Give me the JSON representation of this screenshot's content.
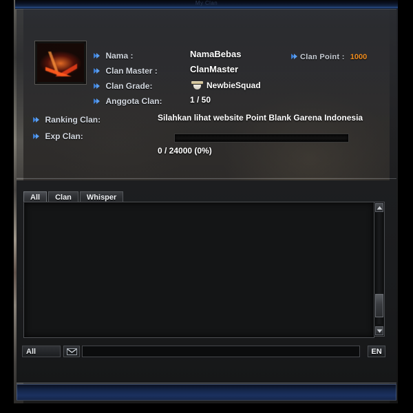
{
  "window": {
    "title": "My Clan"
  },
  "clan_info": {
    "emblem_alt": "clan-emblem",
    "fields": [
      {
        "label": "Nama :",
        "value": "NamaBebas"
      },
      {
        "label": "Clan Master :",
        "value": "ClanMaster"
      },
      {
        "label": "Clan Grade:",
        "value": "NewbieSquad"
      },
      {
        "label": "Anggota Clan:",
        "value": "1 / 50"
      }
    ],
    "clan_point": {
      "label": "Clan Point :",
      "value": "1000",
      "value_color": "#f08c1e"
    },
    "ranking": {
      "label": "Ranking Clan:",
      "value": "Silahkan lihat website Point Blank Garena Indonesia"
    },
    "exp": {
      "label": "Exp Clan:",
      "value": "0 / 24000 (0%)",
      "percent": 0,
      "current": 0,
      "max": 24000
    }
  },
  "chat": {
    "tabs": [
      {
        "label": "All",
        "active": true
      },
      {
        "label": "Clan",
        "active": false
      },
      {
        "label": "Whisper",
        "active": false
      }
    ],
    "log": "",
    "scrollbar": {
      "up_icon": "triangle-up-icon",
      "down_icon": "triangle-down-icon"
    },
    "input_bar": {
      "scope": "All",
      "mail_icon": "envelope-icon",
      "message": "",
      "placeholder": "",
      "language": "EN"
    }
  }
}
